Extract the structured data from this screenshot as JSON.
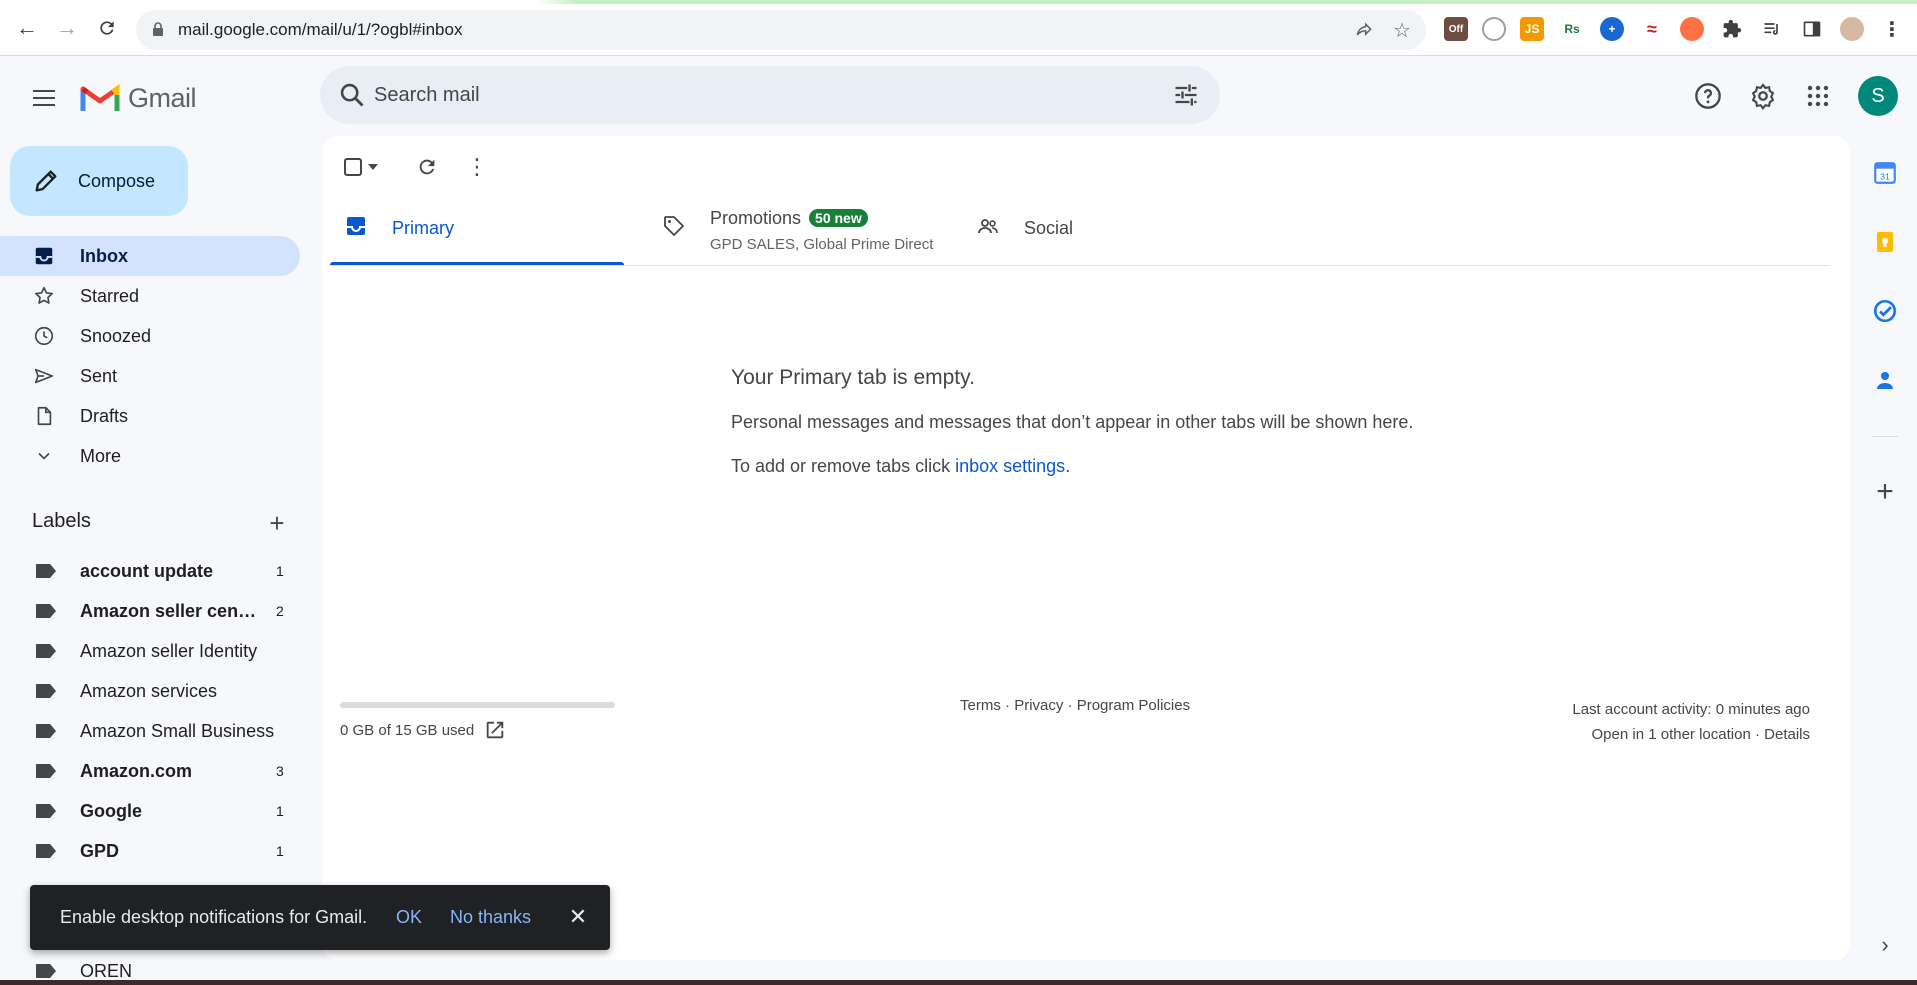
{
  "browser": {
    "url": "mail.google.com/mail/u/1/?ogbl#inbox",
    "extensions": [
      {
        "name": "off-extension-icon",
        "label": "Off",
        "color": "#6d4c41"
      },
      {
        "name": "swirl-extension-icon",
        "label": "",
        "color": "#ffffff"
      },
      {
        "name": "js-extension-icon",
        "label": "JS",
        "color": "#f29900"
      },
      {
        "name": "rs-extension-icon",
        "label": "Rs",
        "color": "#ffffff"
      },
      {
        "name": "blue-plus-extension-icon",
        "label": "",
        "color": "#1967d2"
      },
      {
        "name": "red-extension-icon",
        "label": "",
        "color": "#ffffff"
      },
      {
        "name": "orange-circle-extension-icon",
        "label": "",
        "color": "#ff7043"
      }
    ]
  },
  "app": {
    "name": "Gmail"
  },
  "search": {
    "placeholder": "Search mail"
  },
  "user": {
    "avatar_letter": "S",
    "avatar_color": "#00897b"
  },
  "sidebar": {
    "compose_label": "Compose",
    "nav": [
      {
        "label": "Inbox",
        "icon": "inbox-icon",
        "active": true
      },
      {
        "label": "Starred",
        "icon": "star-icon",
        "active": false
      },
      {
        "label": "Snoozed",
        "icon": "clock-icon",
        "active": false
      },
      {
        "label": "Sent",
        "icon": "send-icon",
        "active": false
      },
      {
        "label": "Drafts",
        "icon": "draft-icon",
        "active": false
      },
      {
        "label": "More",
        "icon": "chevron-down-icon",
        "active": false
      }
    ],
    "labels_heading": "Labels",
    "labels": [
      {
        "name": "account update",
        "count": "1",
        "bold": true
      },
      {
        "name": "Amazon seller cent…",
        "count": "2",
        "bold": true
      },
      {
        "name": "Amazon seller Identity",
        "count": "",
        "bold": false
      },
      {
        "name": "Amazon services",
        "count": "",
        "bold": false
      },
      {
        "name": "Amazon Small Business",
        "count": "",
        "bold": false
      },
      {
        "name": "Amazon.com",
        "count": "3",
        "bold": true
      },
      {
        "name": "Google",
        "count": "1",
        "bold": true
      },
      {
        "name": "GPD",
        "count": "1",
        "bold": true
      },
      {
        "name": "OREN",
        "count": "",
        "bold": false
      }
    ]
  },
  "tabs": [
    {
      "label": "Primary",
      "icon": "inbox-tab-icon",
      "active": true,
      "subtitle": "",
      "badge": ""
    },
    {
      "label": "Promotions",
      "icon": "tag-icon",
      "active": false,
      "subtitle": "GPD SALES, Global Prime Direct",
      "badge": "50 new"
    },
    {
      "label": "Social",
      "icon": "people-icon",
      "active": false,
      "subtitle": "",
      "badge": ""
    }
  ],
  "empty_state": {
    "title": "Your Primary tab is empty.",
    "line1": "Personal messages and messages that don’t appear in other tabs will be shown here.",
    "line2_prefix": "To add or remove tabs click ",
    "line2_link": "inbox settings",
    "line2_suffix": "."
  },
  "footer": {
    "storage_text": "0 GB of 15 GB used",
    "storage_fraction": 0.0,
    "terms": "Terms",
    "privacy": "Privacy",
    "policies": "Program Policies",
    "separator": " · ",
    "activity": "Last account activity: 0 minutes ago",
    "other_location": "Open in 1 other location",
    "details": "Details"
  },
  "toast": {
    "message": "Enable desktop notifications for Gmail.",
    "ok": "OK",
    "no_thanks": "No thanks"
  },
  "colors": {
    "accent": "#0b57d0",
    "compose_bg": "#c2e7ff",
    "active_nav_bg": "#d3e3fd",
    "badge_green": "#188038",
    "toast_bg": "#202124"
  }
}
